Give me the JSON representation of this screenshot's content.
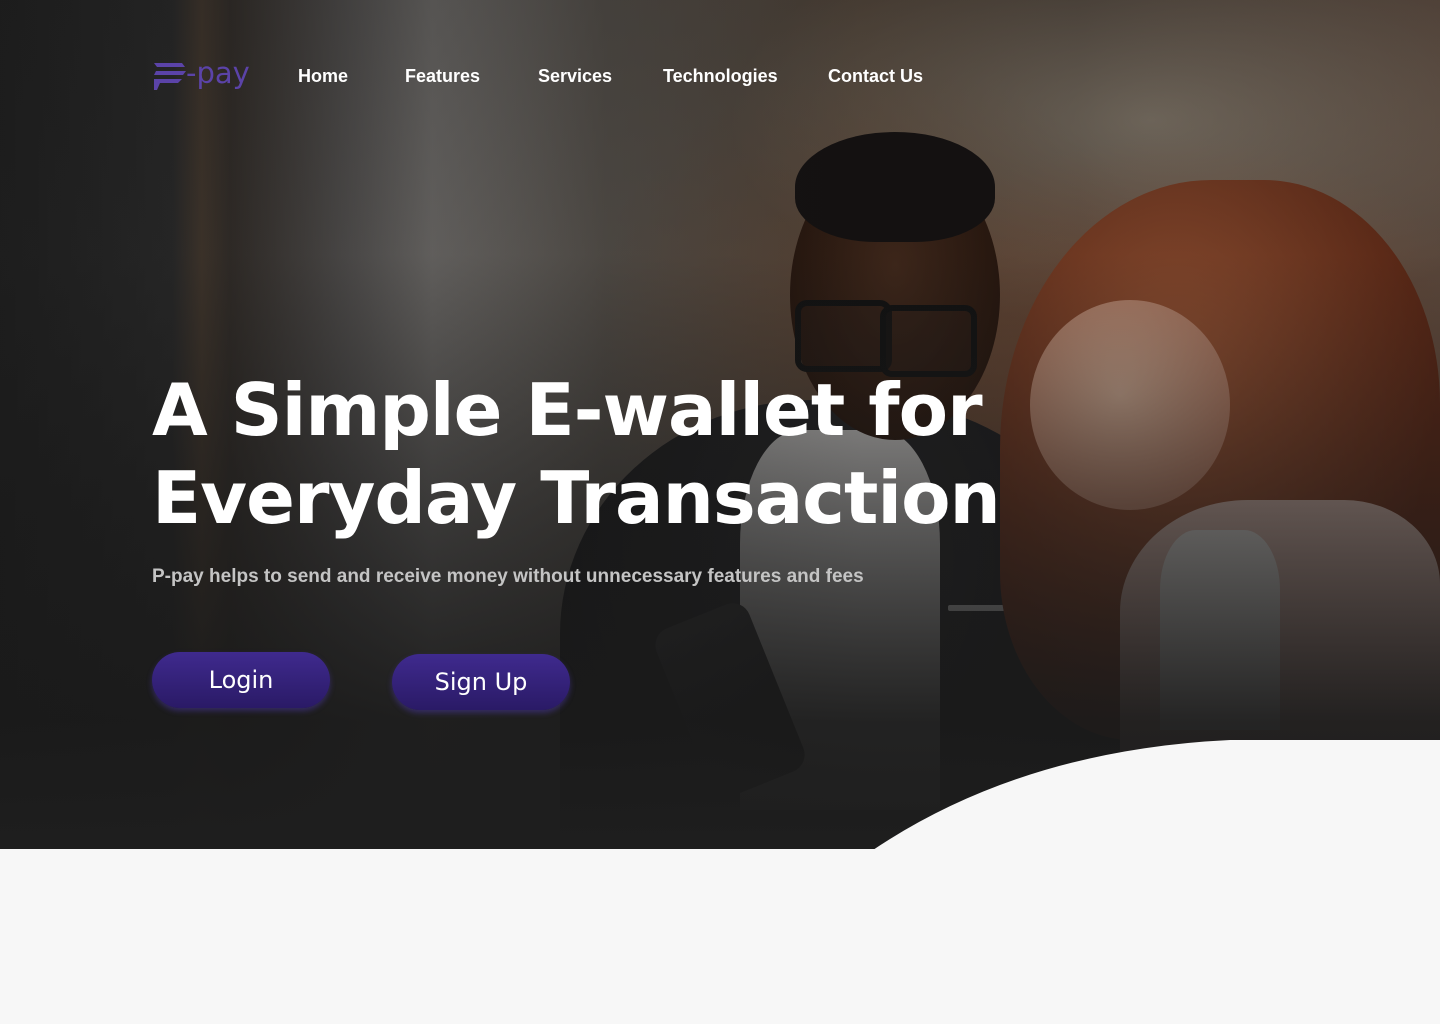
{
  "brand": {
    "logo_text": "-pay",
    "logo_color": "#5b43a8"
  },
  "nav": {
    "items": [
      {
        "label": "Home"
      },
      {
        "label": "Features"
      },
      {
        "label": "Services"
      },
      {
        "label": "Technologies"
      },
      {
        "label": "Contact Us"
      }
    ]
  },
  "hero": {
    "headline_line1": "A Simple E-wallet for",
    "headline_line2": "Everyday Transaction",
    "subtitle": "P-pay helps to send and receive money without unnecessary features and fees",
    "login_label": "Login",
    "signup_label": "Sign Up",
    "button_color": "#2f1f78",
    "image_subject": "man and woman looking at a smartphone"
  }
}
